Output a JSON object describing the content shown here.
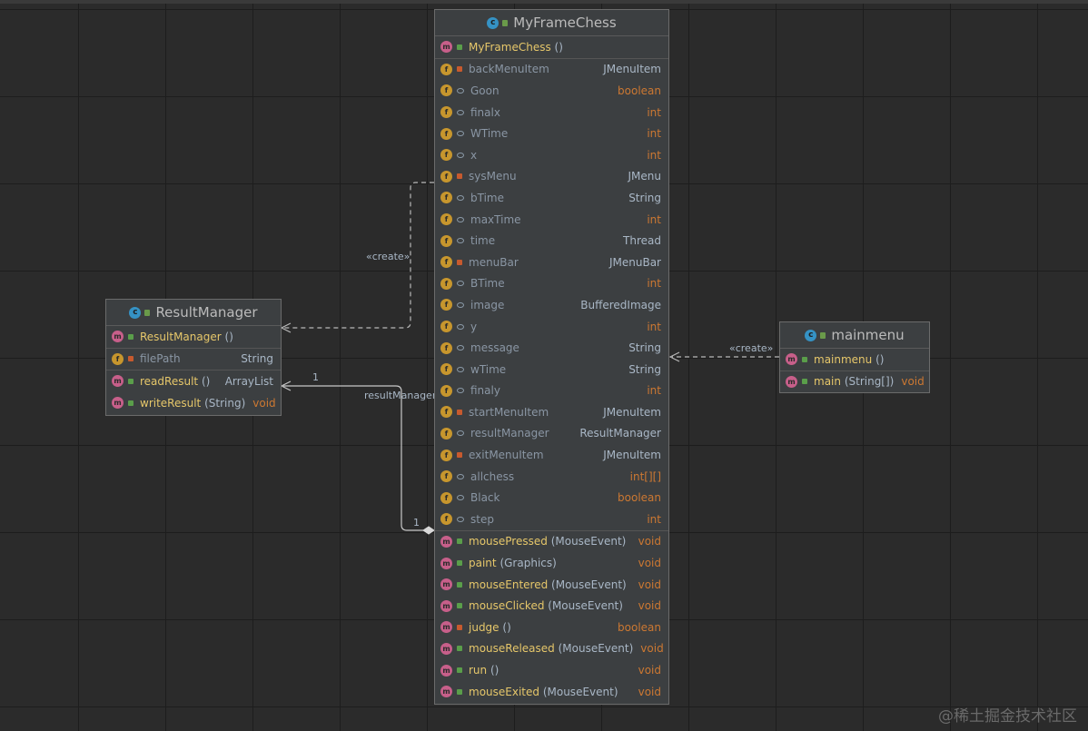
{
  "classes": {
    "myframechess": {
      "title": "MyFrameChess",
      "badge": "c",
      "constructor": {
        "name": "MyFrameChess",
        "params": "()"
      },
      "fields": [
        {
          "name": "backMenuItem",
          "vis": "pri",
          "type": "JMenuItem",
          "prim": false
        },
        {
          "name": "Goon",
          "vis": "pkg",
          "type": "boolean",
          "prim": true
        },
        {
          "name": "finalx",
          "vis": "pkg",
          "type": "int",
          "prim": true
        },
        {
          "name": "WTime",
          "vis": "pkg",
          "type": "int",
          "prim": true
        },
        {
          "name": "x",
          "vis": "pkg",
          "type": "int",
          "prim": true
        },
        {
          "name": "sysMenu",
          "vis": "pri",
          "type": "JMenu",
          "prim": false
        },
        {
          "name": "bTime",
          "vis": "pkg",
          "type": "String",
          "prim": false
        },
        {
          "name": "maxTime",
          "vis": "pkg",
          "type": "int",
          "prim": true
        },
        {
          "name": "time",
          "vis": "pkg",
          "type": "Thread",
          "prim": false
        },
        {
          "name": "menuBar",
          "vis": "pri",
          "type": "JMenuBar",
          "prim": false
        },
        {
          "name": "BTime",
          "vis": "pkg",
          "type": "int",
          "prim": true
        },
        {
          "name": "image",
          "vis": "pkg",
          "type": "BufferedImage",
          "prim": false
        },
        {
          "name": "y",
          "vis": "pkg",
          "type": "int",
          "prim": true
        },
        {
          "name": "message",
          "vis": "pkg",
          "type": "String",
          "prim": false
        },
        {
          "name": "wTime",
          "vis": "pkg",
          "type": "String",
          "prim": false
        },
        {
          "name": "finaly",
          "vis": "pkg",
          "type": "int",
          "prim": true
        },
        {
          "name": "startMenuItem",
          "vis": "pri",
          "type": "JMenuItem",
          "prim": false
        },
        {
          "name": "resultManager",
          "vis": "pkg",
          "type": "ResultManager",
          "prim": false
        },
        {
          "name": "exitMenuItem",
          "vis": "pri",
          "type": "JMenuItem",
          "prim": false
        },
        {
          "name": "allchess",
          "vis": "pkg",
          "type": "int[][]",
          "prim": true
        },
        {
          "name": "Black",
          "vis": "pkg",
          "type": "boolean",
          "prim": true
        },
        {
          "name": "step",
          "vis": "pkg",
          "type": "int",
          "prim": true
        }
      ],
      "methods": [
        {
          "name": "mousePressed",
          "vis": "pub",
          "params": "(MouseEvent)",
          "type": "void"
        },
        {
          "name": "paint",
          "vis": "pub",
          "params": "(Graphics)",
          "type": "void"
        },
        {
          "name": "mouseEntered",
          "vis": "pub",
          "params": "(MouseEvent)",
          "type": "void"
        },
        {
          "name": "mouseClicked",
          "vis": "pub",
          "params": "(MouseEvent)",
          "type": "void"
        },
        {
          "name": "judge",
          "vis": "pri",
          "params": "()",
          "type": "boolean"
        },
        {
          "name": "mouseReleased",
          "vis": "pub",
          "params": "(MouseEvent)",
          "type": "void"
        },
        {
          "name": "run",
          "vis": "pub",
          "params": "()",
          "type": "void"
        },
        {
          "name": "mouseExited",
          "vis": "pub",
          "params": "(MouseEvent)",
          "type": "void"
        }
      ]
    },
    "resultmanager": {
      "title": "ResultManager",
      "badge": "c",
      "constructor": {
        "name": "ResultManager",
        "params": "()"
      },
      "fields": [
        {
          "name": "filePath",
          "vis": "pri",
          "type": "String",
          "prim": false
        }
      ],
      "methods": [
        {
          "name": "readResult",
          "vis": "pub",
          "params": "()",
          "type": "ArrayList",
          "prim": false
        },
        {
          "name": "writeResult",
          "vis": "pub",
          "params": "(String)",
          "type": "void",
          "prim": true
        }
      ]
    },
    "mainmenu": {
      "title": "mainmenu",
      "badge": "c",
      "constructor": {
        "name": "mainmenu",
        "params": "()"
      },
      "methods": [
        {
          "name": "main",
          "vis": "pub",
          "params": "(String[])",
          "type": "void",
          "prim": true
        }
      ]
    }
  },
  "relations": {
    "create_label_left": "«create»",
    "create_label_right": "«create»",
    "association_label": "resultManager",
    "mult_top": "1",
    "mult_bottom": "1"
  },
  "watermark": "@稀土掘金技术社区",
  "colors": {
    "background": "#2b2b2b",
    "box": "#3c3f41",
    "method_name": "#e6c76a",
    "field_name": "#8a96a4",
    "primitive_type": "#cc7832"
  }
}
